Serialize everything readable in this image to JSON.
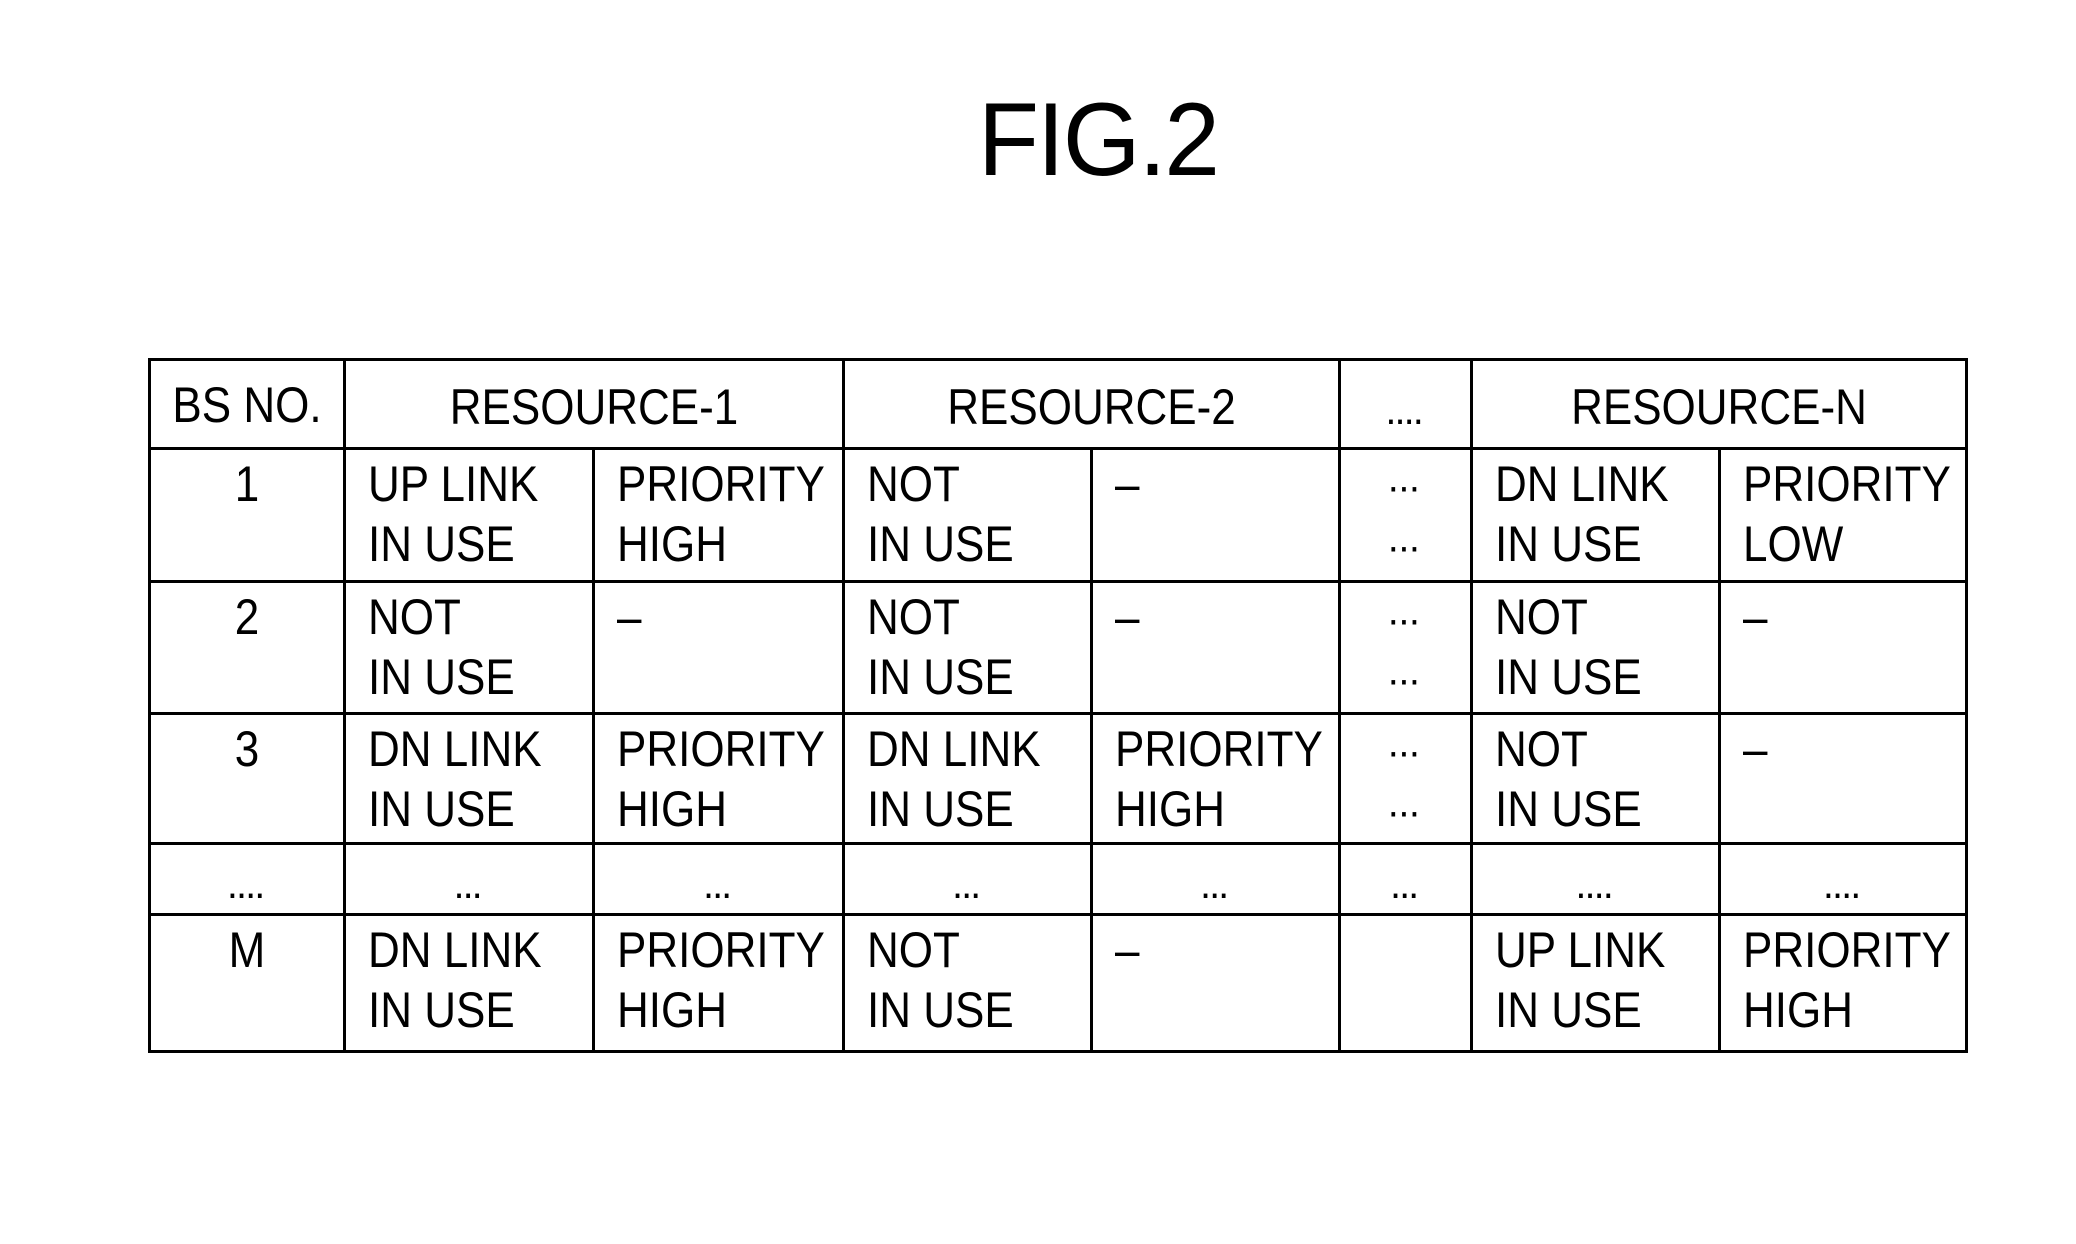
{
  "figure": {
    "title": "FIG.2"
  },
  "table": {
    "header": {
      "bs_no": "BS NO.",
      "resources": [
        "RESOURCE-1",
        "RESOURCE-2",
        "....",
        "RESOURCE-N"
      ]
    },
    "rows": [
      {
        "bs": "1",
        "cells": [
          "UP LINK\nIN USE",
          "PRIORITY\nHIGH",
          "NOT\nIN USE",
          "–",
          "···\n···",
          "DN LINK\nIN USE",
          "PRIORITY\nLOW"
        ]
      },
      {
        "bs": "2",
        "cells": [
          "NOT\nIN USE",
          "–",
          "NOT\nIN USE",
          "–",
          "···\n···",
          "NOT\nIN USE",
          "–"
        ]
      },
      {
        "bs": "3",
        "cells": [
          "DN LINK\nIN USE",
          "PRIORITY\nHIGH",
          "DN LINK\nIN USE",
          "PRIORITY\nHIGH",
          "···\n···",
          "NOT\nIN USE",
          "–"
        ]
      },
      {
        "bs": "....",
        "cells": [
          "...",
          "...",
          "...",
          "...",
          "...",
          "....",
          "...."
        ]
      },
      {
        "bs": "M",
        "cells": [
          "DN LINK\nIN USE",
          "PRIORITY\nHIGH",
          "NOT\nIN USE",
          "–",
          "",
          "UP LINK\nIN USE",
          "PRIORITY\nHIGH"
        ]
      }
    ]
  }
}
